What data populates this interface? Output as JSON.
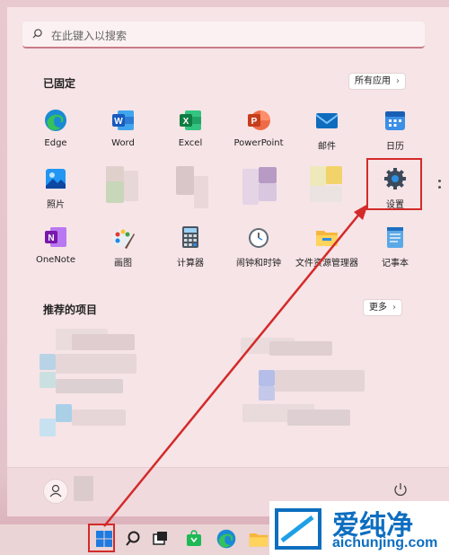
{
  "search": {
    "placeholder": "在此键入以搜索"
  },
  "pinned": {
    "title": "已固定",
    "all_apps": "所有应用",
    "apps": [
      {
        "label": "Edge",
        "icon": "edge-icon"
      },
      {
        "label": "Word",
        "icon": "word-icon"
      },
      {
        "label": "Excel",
        "icon": "excel-icon"
      },
      {
        "label": "PowerPoint",
        "icon": "powerpoint-icon"
      },
      {
        "label": "邮件",
        "icon": "mail-icon"
      },
      {
        "label": "日历",
        "icon": "calendar-icon"
      },
      {
        "label": "照片",
        "icon": "photos-icon"
      },
      {
        "label": "设置",
        "icon": "settings-icon"
      },
      {
        "label": "OneNote",
        "icon": "onenote-icon"
      },
      {
        "label": "画图",
        "icon": "paint-icon"
      },
      {
        "label": "计算器",
        "icon": "calculator-icon"
      },
      {
        "label": "闹钟和时钟",
        "icon": "clock-icon"
      },
      {
        "label": "文件资源管理器",
        "icon": "folder-icon"
      },
      {
        "label": "记事本",
        "icon": "notepad-icon"
      }
    ]
  },
  "recommended": {
    "title": "推荐的项目",
    "more": "更多"
  },
  "watermark": {
    "brand": "爱纯净",
    "url": "aichunjing.com"
  },
  "colors": {
    "highlight": "#d32a2a",
    "accent": "#0078d4"
  }
}
